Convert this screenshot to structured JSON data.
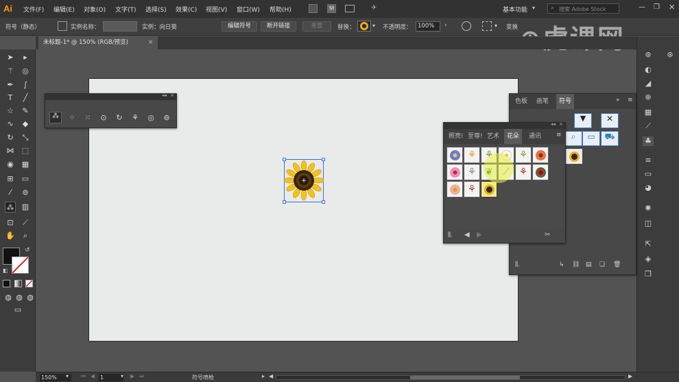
{
  "app": {
    "logo": "Ai",
    "workspace": "基本功能",
    "search_placeholder": "搜索 Adobe Stock"
  },
  "menu": [
    "文件(F)",
    "编辑(E)",
    "对象(O)",
    "文字(T)",
    "选择(S)",
    "效果(C)",
    "视图(V)",
    "窗口(W)",
    "帮助(H)"
  ],
  "control": {
    "object_type": "符号（静态）",
    "instance_name_label": "实例名称：",
    "instance_label": "实例：向日葵",
    "edit_symbol": "编辑符号",
    "break_link": "断开链接",
    "reset": "重置",
    "replace_label": "替换：",
    "opacity_label": "不透明度：",
    "opacity_value": "100%",
    "transform": "变换"
  },
  "document_tab": "未标题-1* @ 150% (RGB/预览)",
  "symbols_panel": {
    "tabs": [
      "色板",
      "画笔",
      "符号"
    ],
    "active": "符号"
  },
  "flowers_panel": {
    "tabs": [
      "照亮!",
      "至尊!",
      "艺术",
      "花朵",
      "通讯"
    ],
    "active": "花朵"
  },
  "status": {
    "zoom": "150%",
    "page": "1",
    "tool": "符号喷枪"
  },
  "watermark": "虎课网",
  "colors": {
    "accent_logo": "#ff9a00",
    "selection": "#3a6fd8"
  }
}
